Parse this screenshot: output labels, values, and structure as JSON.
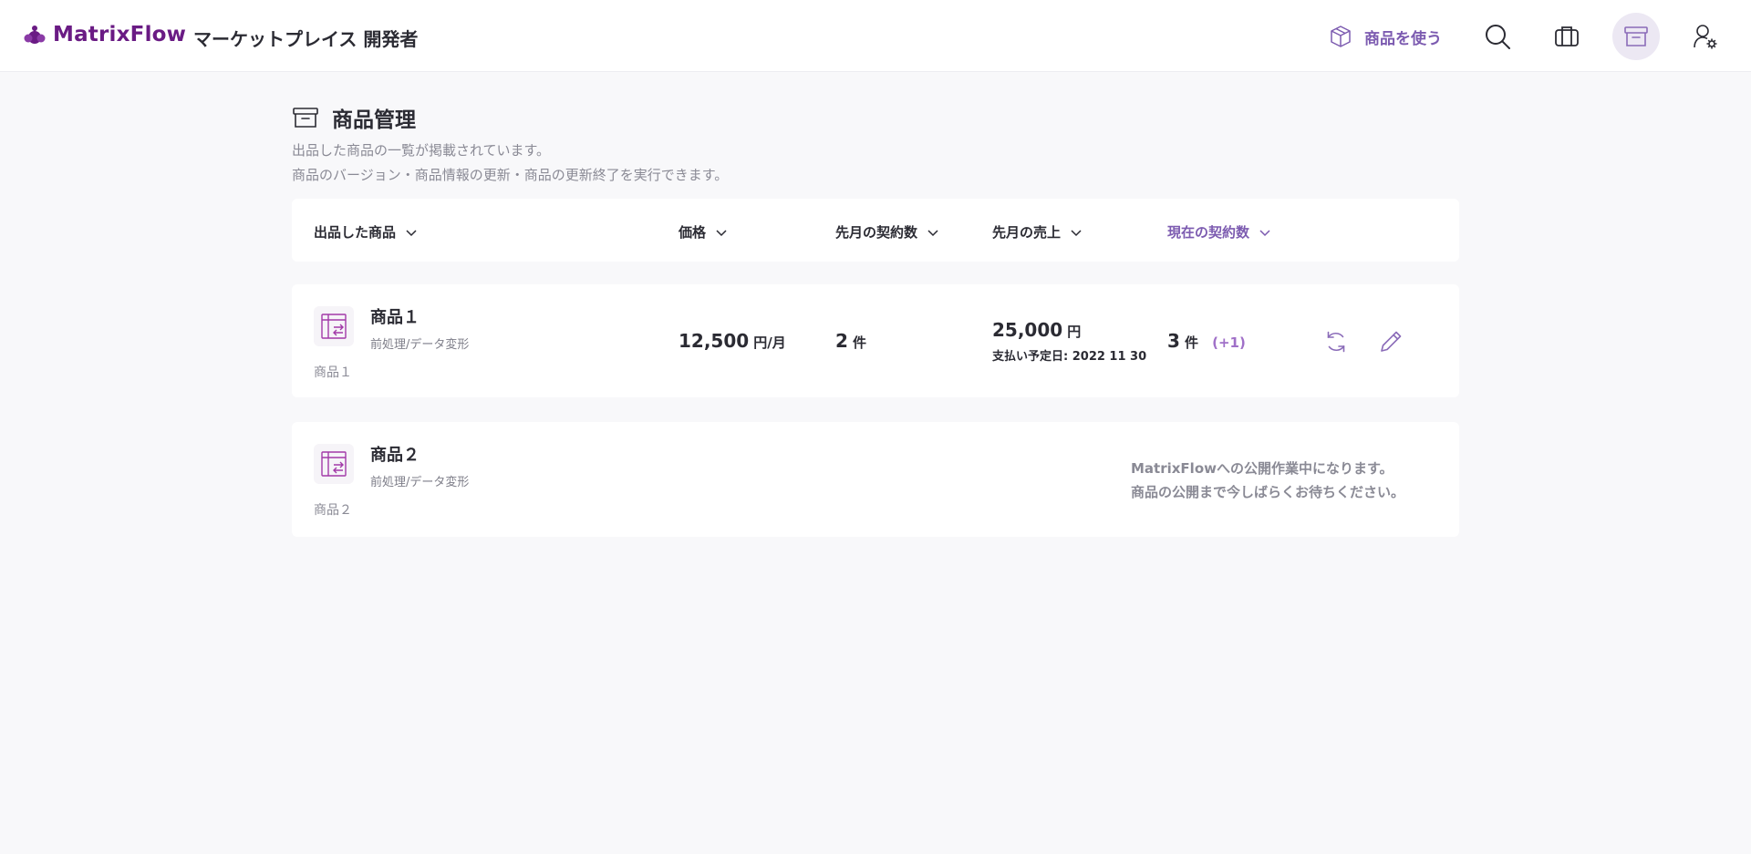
{
  "header": {
    "brand": "MatrixFlow",
    "title": "マーケットプレイス 開発者",
    "use_products_label": "商品を使う",
    "colors": {
      "brand": "#6a1b84",
      "accent": "#7c5bb0"
    },
    "icons": [
      "cube-icon",
      "search-icon",
      "briefcase-icon",
      "archive-box-icon",
      "user-settings-icon"
    ]
  },
  "page": {
    "title": "商品管理",
    "desc_line1": "出品した商品の一覧が掲載されています。",
    "desc_line2": "商品のバージョン・商品情報の更新・商品の更新終了を実行できます。"
  },
  "columns": {
    "product": "出品した商品",
    "price": "価格",
    "last_month_contracts": "先月の契約数",
    "last_month_sales": "先月の売上",
    "current_contracts": "現在の契約数",
    "sort_icon": "chevron-down-icon"
  },
  "products": [
    {
      "name": "商品１",
      "category": "前処理/データ変形",
      "subtitle": "商品１",
      "price": "12,500",
      "price_unit": "円/月",
      "last_contracts": "2",
      "last_contracts_unit": "件",
      "sales": "25,000",
      "sales_unit": "円",
      "payment_date": "支払い予定日: 2022 11 30",
      "current_contracts": "3",
      "current_contracts_unit": "件",
      "current_delta": "(+1)",
      "actions": [
        "refresh-icon",
        "edit-icon"
      ]
    },
    {
      "name": "商品２",
      "category": "前処理/データ変形",
      "subtitle": "商品２",
      "notice_line1": "MatrixFlowへの公開作業中になります。",
      "notice_line2": "商品の公開まで今しばらくお待ちください。"
    }
  ]
}
